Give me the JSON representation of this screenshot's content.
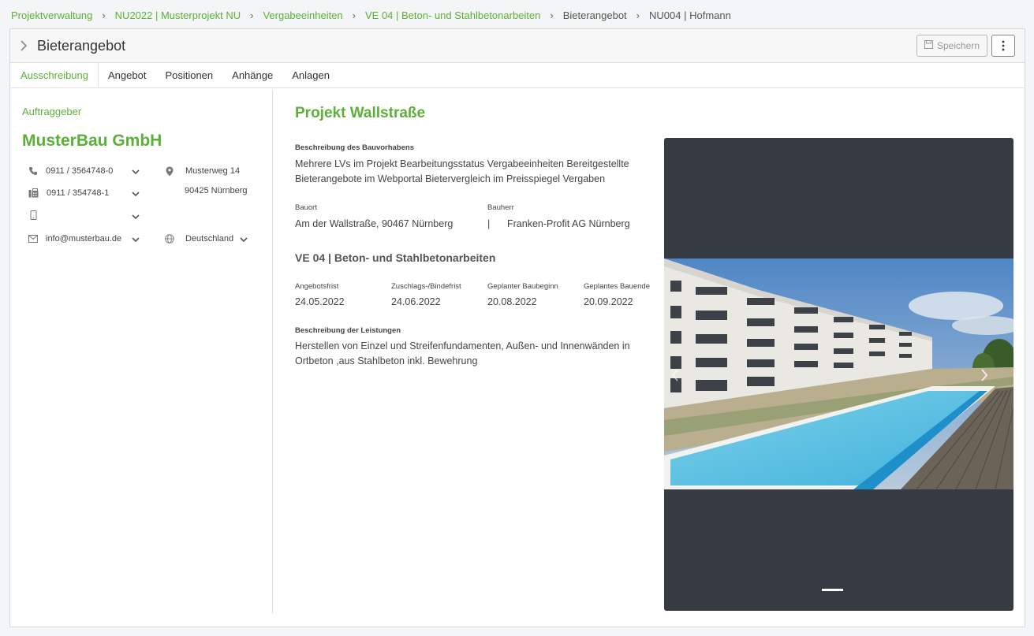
{
  "breadcrumb": [
    {
      "label": "Projektverwaltung",
      "link": true
    },
    {
      "label": "NU2022 | Musterprojekt NU",
      "link": true
    },
    {
      "label": "Vergabeeinheiten",
      "link": true
    },
    {
      "label": "VE 04 | Beton- und Stahlbetonarbeiten",
      "link": true
    },
    {
      "label": "Bieterangebot",
      "link": false
    },
    {
      "label": "NU004 | Hofmann",
      "link": false
    }
  ],
  "header": {
    "title": "Bieterangebot",
    "save_label": "Speichern"
  },
  "tabs": [
    {
      "label": "Ausschreibung",
      "active": true
    },
    {
      "label": "Angebot",
      "active": false
    },
    {
      "label": "Positionen",
      "active": false
    },
    {
      "label": "Anhänge",
      "active": false
    },
    {
      "label": "Anlagen",
      "active": false
    }
  ],
  "client": {
    "section_label": "Auftraggeber",
    "company": "MusterBau GmbH",
    "phone": "0911 / 3564748-0",
    "fax": "0911 / 354748-1",
    "mobile": "",
    "email": "info@musterbau.de",
    "street": "Musterweg 14",
    "city": "90425 Nürnberg",
    "country": "Deutschland"
  },
  "project": {
    "title": "Projekt Wallstraße",
    "desc_label": "Beschreibung des Bauvorhabens",
    "desc": "Mehrere LVs im Projekt Bearbeitungsstatus Vergabeeinheiten Bereitgestellte Bieterangebote im Webportal Bietervergleich im Preisspiegel Vergaben",
    "bauort_label": "Bauort",
    "bauort": "Am der Wallstraße, 90467 Nürnberg",
    "bauherr_label": "Bauherr",
    "bauherr_sep": "|",
    "bauherr": "Franken-Profit AG Nürnberg"
  },
  "ve": {
    "title": "VE 04 | Beton- und Stahlbetonarbeiten",
    "dates": [
      {
        "label": "Angebotsfrist",
        "value": "24.05.2022"
      },
      {
        "label": "Zuschlags-/Bindefrist",
        "value": "24.06.2022"
      },
      {
        "label": "Geplanter Baubeginn",
        "value": "20.08.2022"
      },
      {
        "label": "Geplantes Bauende",
        "value": "20.09.2022"
      }
    ],
    "leist_label": "Beschreibung der Leistungen",
    "leist": "Herstellen von Einzel und Streifenfundamenten, Außen- und Innenwänden in Ortbeton ,aus Stahlbeton inkl. Bewehrung"
  },
  "icons": {
    "phone": "phone-icon",
    "fax": "fax-icon",
    "mobile": "mobile-icon",
    "email": "envelope-icon",
    "location": "map-pin-icon",
    "globe": "globe-icon",
    "save": "floppy-disk-icon",
    "more": "vertical-ellipsis-icon"
  },
  "colors": {
    "accent": "#5cb039",
    "slider_bg": "#363a42"
  }
}
